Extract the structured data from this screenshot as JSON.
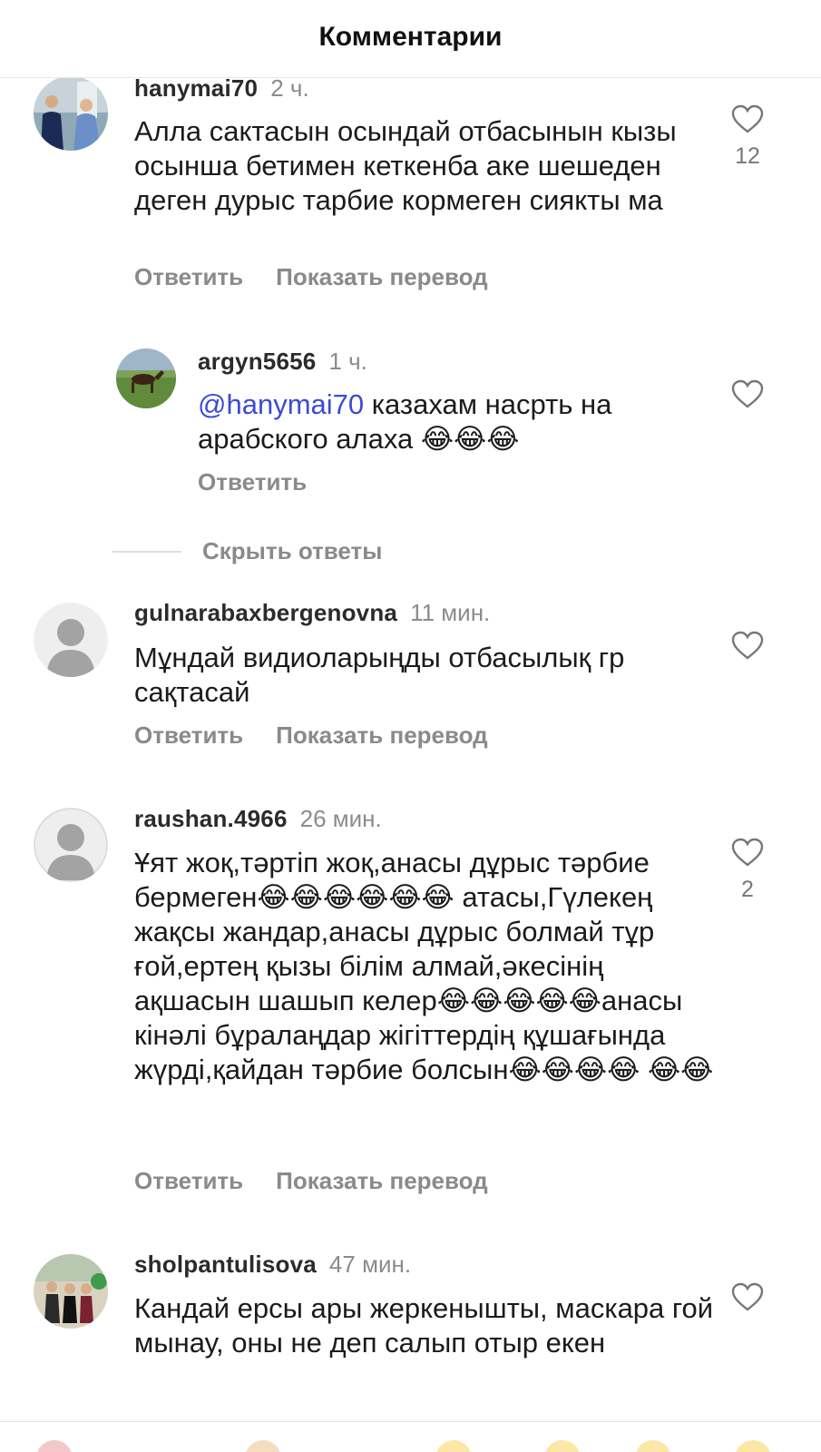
{
  "header": {
    "title": "Комментарии"
  },
  "comments": [
    {
      "username": "hanymai70",
      "time": "2 ч.",
      "text": "Алла сактасын осындай отбасынын кызы осынша бетимен кеткенба аке шешеден деген дурыс тарбие кормеген сиякты ма",
      "likes": "12",
      "reply": "Ответить",
      "translate": "Показать перевод"
    },
    {
      "username": "argyn5656",
      "time": "1 ч.",
      "mention": "@hanymai70",
      "text": " казахам насрть на арабского алаха 😂😂😂",
      "reply": "Ответить"
    },
    {
      "username": "gulnarabaxbergenovna",
      "time": "11 мин.",
      "text": "Мұндай видиоларыңды отбасылық гр сақтасай",
      "reply": "Ответить",
      "translate": "Показать перевод"
    },
    {
      "username": "raushan.4966",
      "time": "26 мин.",
      "text": "Ұят жоқ,тәртіп жоқ,анасы дұрыс тәрбие бермеген😂😂😂😂😂😂 атасы,Гүлекең жақсы жандар,анасы дұрыс болмай тұр ғой,ертең қызы білім алмай,әкесінің ақшасын шашып келер😂😂😂😂😂анасы кінәлі бұралаңдар жігіттердің құшағында жүрді,қайдан тәрбие болсын😂😂😂😂 😂😂",
      "likes": "2",
      "reply": "Ответить",
      "translate": "Показать перевод"
    },
    {
      "username": "sholpantulisova",
      "time": "47 мин.",
      "text": "Кандай ерсы ары жеркенышты, маскара гой мынау, оны не деп салып отыр екен"
    }
  ],
  "replies_toggle": "Скрыть ответы",
  "icons": {
    "like": "heart-outline-icon",
    "default_avatar": "default-user-avatar"
  },
  "colors": {
    "mention": "#3b4bd6",
    "muted": "#8a8a8a"
  }
}
